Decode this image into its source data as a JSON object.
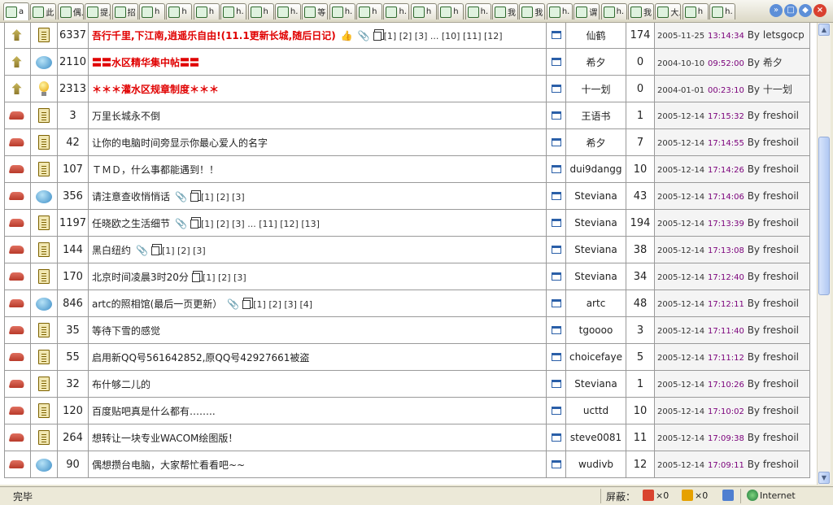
{
  "tabs": [
    "a",
    "此",
    "偶.",
    "提.",
    "招",
    "h",
    "h",
    "h",
    "h.",
    "h",
    "h.",
    "等",
    "h.",
    "h",
    "h.",
    "h",
    "h",
    "h.",
    "我",
    "我",
    "h.",
    "谓",
    "h.",
    "我",
    "大.",
    "h",
    "h."
  ],
  "tab_controls": [
    "»",
    "□",
    "◆",
    "×"
  ],
  "status": {
    "text": "完毕",
    "block_label": "屏蔽：",
    "popups": "×0",
    "flash": "×0",
    "zone": "Internet"
  },
  "rows": [
    {
      "state": "up",
      "mood": "doc",
      "views": "6337",
      "title": "吾行千里,下江南,逍遥乐自由!(11.1更新长城,随后日记)",
      "hot": true,
      "thumb": true,
      "clip": true,
      "multi": true,
      "pages": "[1] [2] [3] ... [10] [11] [12]",
      "author": "仙鹤",
      "replies": "174",
      "date": "2005-11-25",
      "time": "13:14:34",
      "by": "By",
      "last": "letsgocp"
    },
    {
      "state": "up",
      "mood": "smile",
      "views": "2110",
      "title": "〓〓水区精华集中帖〓〓",
      "hot": true,
      "thumb": false,
      "clip": false,
      "multi": false,
      "pages": "",
      "author": "希夕",
      "replies": "0",
      "date": "2004-10-10",
      "time": "09:52:00",
      "by": "By",
      "last": "希夕"
    },
    {
      "state": "up",
      "mood": "bulb",
      "views": "2313",
      "title": "＊＊＊灌水区规章制度＊＊＊",
      "hot": true,
      "thumb": false,
      "clip": false,
      "multi": false,
      "pages": "",
      "author": "十一划",
      "replies": "0",
      "date": "2004-01-01",
      "time": "00:23:10",
      "by": "By",
      "last": "十一划"
    },
    {
      "state": "shoe",
      "mood": "doc",
      "views": "3",
      "title": "万里长城永不倒",
      "hot": false,
      "thumb": false,
      "clip": false,
      "multi": false,
      "pages": "",
      "author": "王语书",
      "replies": "1",
      "date": "2005-12-14",
      "time": "17:15:32",
      "by": "By",
      "last": "freshoil"
    },
    {
      "state": "shoe",
      "mood": "doc",
      "views": "42",
      "title": "让你的电脑时间旁显示你最心爱人的名字",
      "hot": false,
      "thumb": false,
      "clip": false,
      "multi": false,
      "pages": "",
      "author": "希夕",
      "replies": "7",
      "date": "2005-12-14",
      "time": "17:14:55",
      "by": "By",
      "last": "freshoil"
    },
    {
      "state": "shoe",
      "mood": "doc",
      "views": "107",
      "title": "ＴＭＤ，什么事都能遇到！！",
      "hot": false,
      "thumb": false,
      "clip": false,
      "multi": false,
      "pages": "",
      "author": "dui9dangg",
      "replies": "10",
      "date": "2005-12-14",
      "time": "17:14:26",
      "by": "By",
      "last": "freshoil"
    },
    {
      "state": "shoe",
      "mood": "smile",
      "views": "356",
      "title": "请注意查收悄悄话",
      "hot": false,
      "thumb": false,
      "clip": true,
      "multi": true,
      "pages": "[1] [2] [3]",
      "author": "Steviana",
      "replies": "43",
      "date": "2005-12-14",
      "time": "17:14:06",
      "by": "By",
      "last": "freshoil"
    },
    {
      "state": "shoe",
      "mood": "doc",
      "views": "1197",
      "title": "任晓欧之生活细节",
      "hot": false,
      "thumb": false,
      "clip": true,
      "multi": true,
      "pages": "[1] [2] [3] ... [11] [12] [13]",
      "author": "Steviana",
      "replies": "194",
      "date": "2005-12-14",
      "time": "17:13:39",
      "by": "By",
      "last": "freshoil"
    },
    {
      "state": "shoe",
      "mood": "doc",
      "views": "144",
      "title": "黑白纽约",
      "hot": false,
      "thumb": false,
      "clip": true,
      "multi": true,
      "pages": "[1] [2] [3]",
      "author": "Steviana",
      "replies": "38",
      "date": "2005-12-14",
      "time": "17:13:08",
      "by": "By",
      "last": "freshoil"
    },
    {
      "state": "shoe",
      "mood": "doc",
      "views": "170",
      "title": "北京时间凌晨3时20分",
      "hot": false,
      "thumb": false,
      "clip": false,
      "multi": true,
      "pages": "[1] [2] [3]",
      "author": "Steviana",
      "replies": "34",
      "date": "2005-12-14",
      "time": "17:12:40",
      "by": "By",
      "last": "freshoil"
    },
    {
      "state": "shoe",
      "mood": "smile",
      "views": "846",
      "title": "artc的照相馆(最后一页更新）",
      "hot": false,
      "thumb": false,
      "clip": true,
      "multi": true,
      "pages": "[1] [2] [3] [4]",
      "author": "artc",
      "replies": "48",
      "date": "2005-12-14",
      "time": "17:12:11",
      "by": "By",
      "last": "freshoil"
    },
    {
      "state": "shoe",
      "mood": "doc",
      "views": "35",
      "title": "等待下雪的感觉",
      "hot": false,
      "thumb": false,
      "clip": false,
      "multi": false,
      "pages": "",
      "author": "tgoooo",
      "replies": "3",
      "date": "2005-12-14",
      "time": "17:11:40",
      "by": "By",
      "last": "freshoil"
    },
    {
      "state": "shoe",
      "mood": "doc",
      "views": "55",
      "title": "启用新QQ号561642852,原QQ号42927661被盗",
      "hot": false,
      "thumb": false,
      "clip": false,
      "multi": false,
      "pages": "",
      "author": "choicefaye",
      "replies": "5",
      "date": "2005-12-14",
      "time": "17:11:12",
      "by": "By",
      "last": "freshoil"
    },
    {
      "state": "shoe",
      "mood": "doc",
      "views": "32",
      "title": "布什够二儿的",
      "hot": false,
      "thumb": false,
      "clip": false,
      "multi": false,
      "pages": "",
      "author": "Steviana",
      "replies": "1",
      "date": "2005-12-14",
      "time": "17:10:26",
      "by": "By",
      "last": "freshoil"
    },
    {
      "state": "shoe",
      "mood": "doc",
      "views": "120",
      "title": "百度贴吧真是什么都有……..",
      "hot": false,
      "thumb": false,
      "clip": false,
      "multi": false,
      "pages": "",
      "author": "ucttd",
      "replies": "10",
      "date": "2005-12-14",
      "time": "17:10:02",
      "by": "By",
      "last": "freshoil"
    },
    {
      "state": "shoe",
      "mood": "doc",
      "views": "264",
      "title": "想转让一块专业WACOM绘图版！",
      "hot": false,
      "thumb": false,
      "clip": false,
      "multi": false,
      "pages": "",
      "author": "steve0081",
      "replies": "11",
      "date": "2005-12-14",
      "time": "17:09:38",
      "by": "By",
      "last": "freshoil"
    },
    {
      "state": "shoe",
      "mood": "smile",
      "views": "90",
      "title": "偶想攒台电脑，大家帮忙看看吧~~",
      "hot": false,
      "thumb": false,
      "clip": false,
      "multi": false,
      "pages": "",
      "author": "wudivb",
      "replies": "12",
      "date": "2005-12-14",
      "time": "17:09:11",
      "by": "By",
      "last": "freshoil"
    }
  ]
}
